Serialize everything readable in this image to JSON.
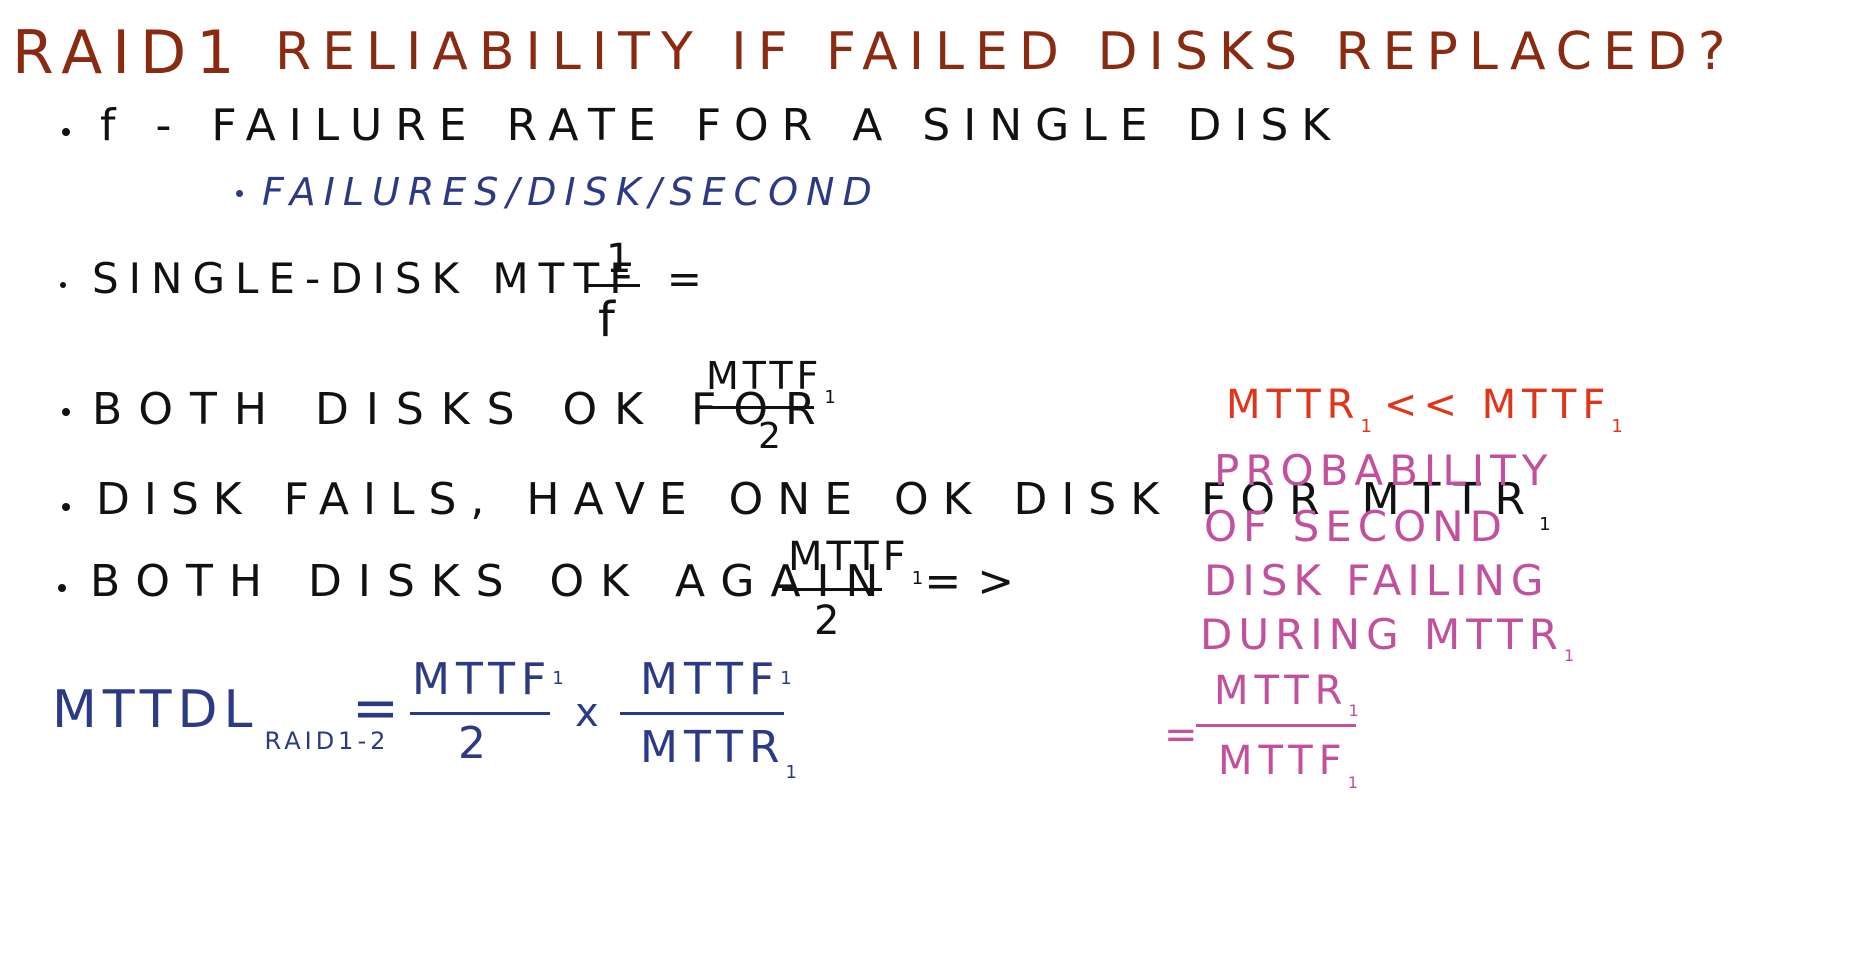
{
  "title": {
    "part1": "RAID1",
    "part2": "RELIABILITY IF FAILED DISKS REPLACED?"
  },
  "bullets": {
    "failure_rate": "f - FAILURE RATE FOR A SINGLE DISK",
    "failure_units": "FAILURES/DISK/SECOND",
    "single_disk_label": "SINGLE-DISK MTTF =",
    "single_disk_num": "1",
    "single_disk_den": "f",
    "both_ok_label": "BOTH DISKS OK FOR",
    "both_ok_num": "MTTF",
    "both_ok_num_sub": "1",
    "both_ok_den": "2",
    "disk_fails": "DISK FAILS, HAVE ONE OK DISK FOR MTTR",
    "disk_fails_sub": "1",
    "both_ok_again_label": "BOTH DISKS OK AGAIN =>",
    "both_ok_again_num": "MTTF",
    "both_ok_again_num_sub": "1",
    "both_ok_again_den": "2"
  },
  "formula": {
    "lhs": "MTTDL",
    "lhs_sub": "RAID1-2",
    "eq": "=",
    "f1_num": "MTTF",
    "f1_num_sub": "1",
    "f1_den": "2",
    "times": "x",
    "f2_num": "MTTF",
    "f2_num_sub": "1",
    "f2_den": "MTTR",
    "f2_den_sub": "1"
  },
  "side_note": {
    "condition": "MTTR",
    "condition_sub1": "1",
    "condition_mid": "<< MTTF",
    "condition_sub2": "1",
    "probability_lines": [
      "PROBABILITY",
      "OF SECOND",
      "DISK FAILING",
      "DURING MTTR"
    ],
    "probability_sub": "1",
    "eq": "=",
    "ratio_num": "MTTR",
    "ratio_num_sub": "1",
    "ratio_den": "MTTF",
    "ratio_den_sub": "1"
  },
  "colors": {
    "title": "#8a2a10",
    "ink": "#111111",
    "blue": "#2c3a86",
    "red": "#e0351a",
    "magenta": "#c2509e"
  }
}
